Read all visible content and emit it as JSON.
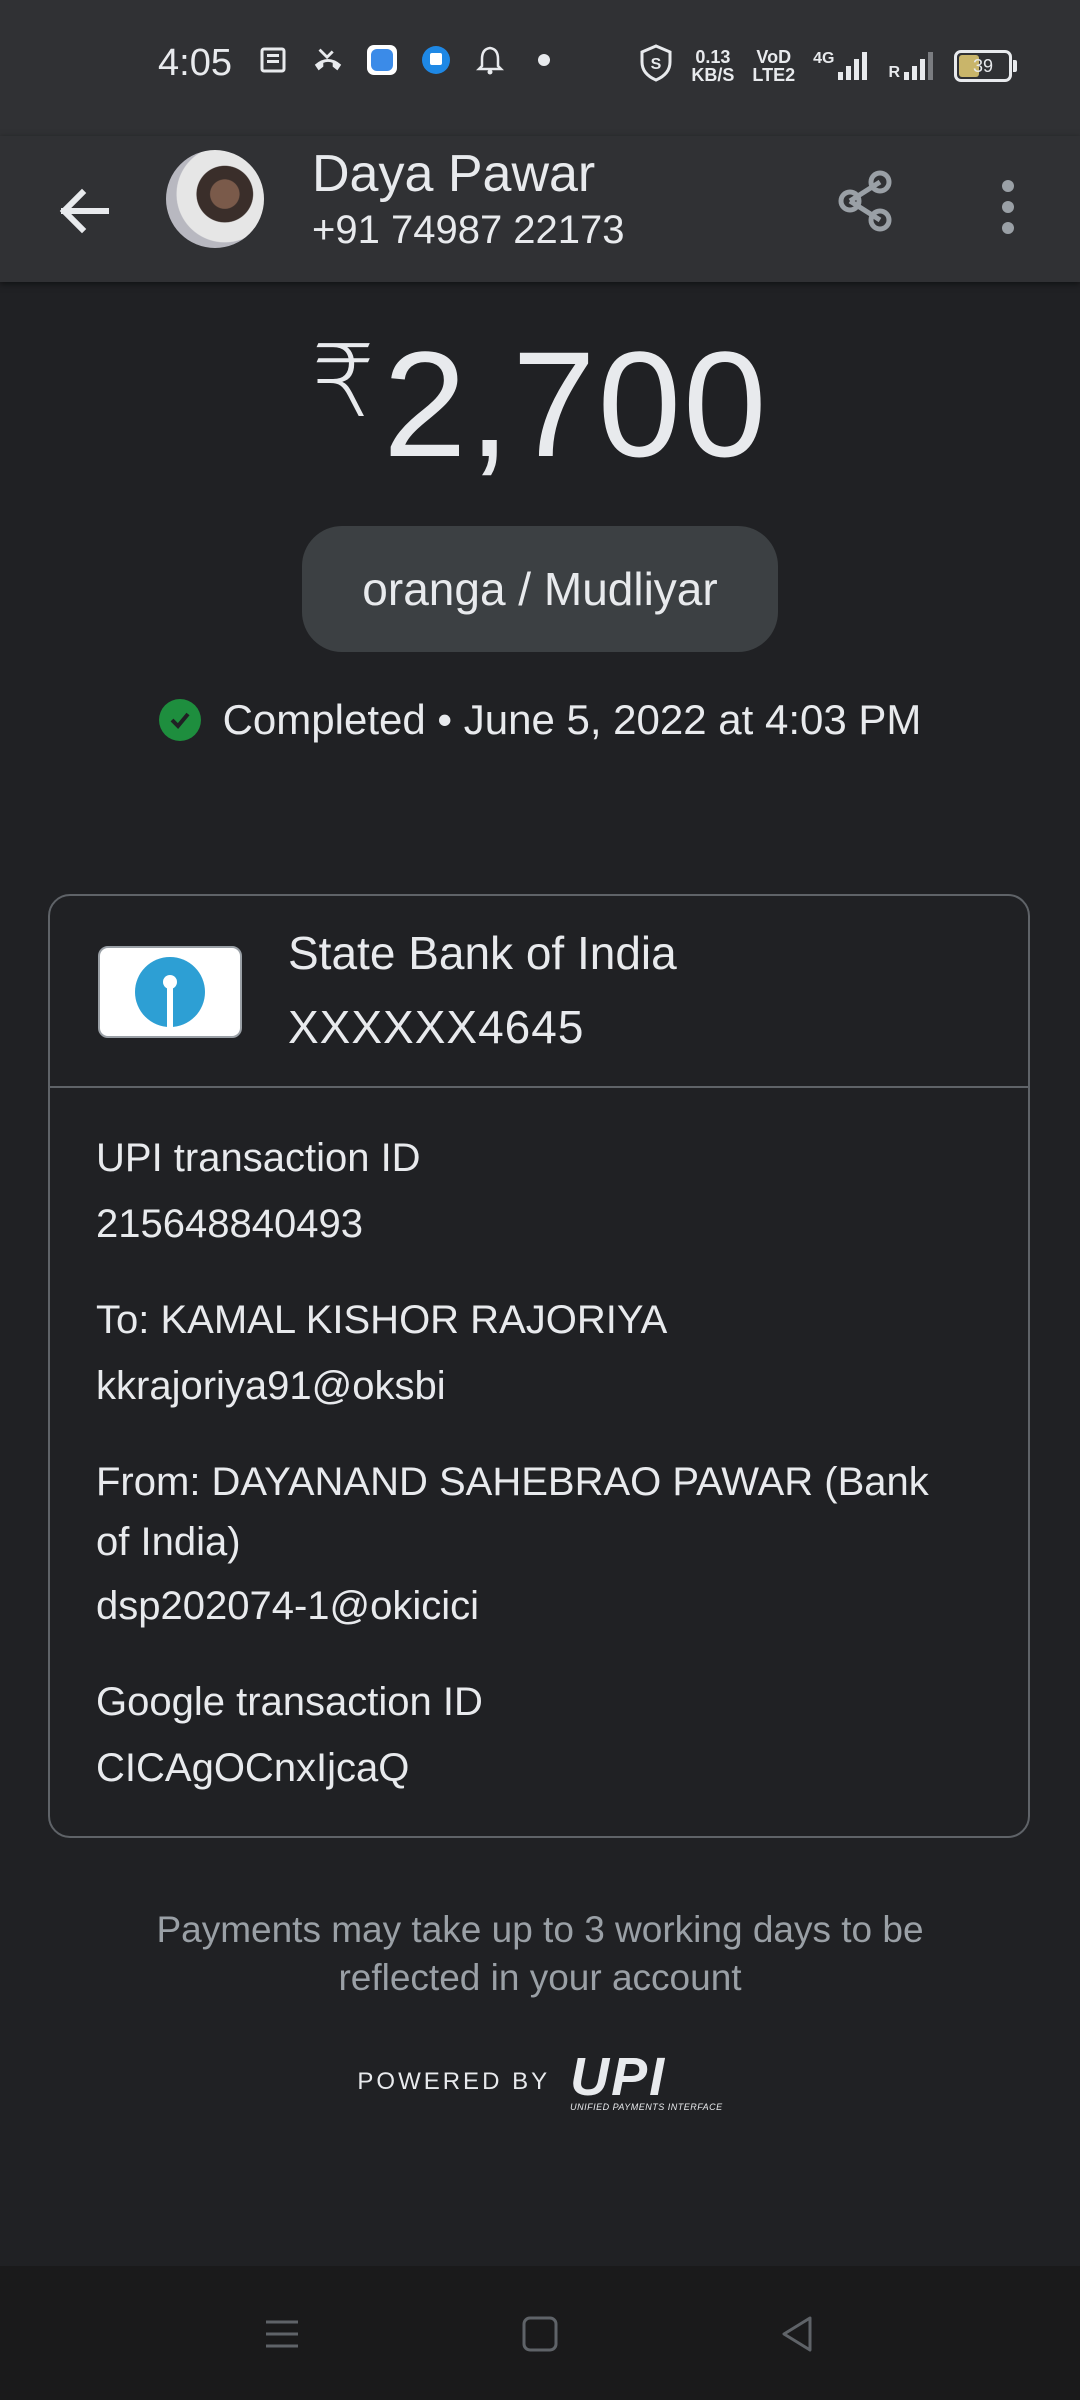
{
  "status_bar": {
    "time": "4:05",
    "net_speed_top": "0.13",
    "net_speed_unit": "KB/S",
    "volte_top": "VoD",
    "volte_bottom": "LTE2",
    "network": "4G",
    "roaming": "R",
    "battery": "39"
  },
  "header": {
    "contact_name": "Daya Pawar",
    "contact_phone": "+91 74987 22173"
  },
  "payment": {
    "currency": "₹",
    "amount": "2,700",
    "note": "oranga / Mudliyar",
    "status": "Completed • June 5, 2022 at 4:03 PM"
  },
  "bank": {
    "name": "State Bank of India",
    "account": "XXXXXX4645"
  },
  "details": {
    "upi_label": "UPI transaction ID",
    "upi_value": "215648840493",
    "to_label": "To: KAMAL KISHOR  RAJORIYA",
    "to_value": "kkrajoriya91@oksbi",
    "from_label_line1": "From: DAYANAND SAHEBRAO PAWAR (Bank",
    "from_label_line2": "of India)",
    "from_value": "dsp202074-1@okicici",
    "google_label": "Google transaction ID",
    "google_value": "CICAgOCnxIjcaQ"
  },
  "footer": {
    "note": "Payments may take up to 3 working days to be reflected in your account",
    "powered_by": "POWERED BY",
    "upi_logo": "UPI",
    "upi_subtitle": "UNIFIED PAYMENTS INTERFACE"
  },
  "colors": {
    "background": "#202124",
    "appbar": "#303134",
    "success": "#1e8e3e",
    "sbi_blue": "#2d9fd4"
  }
}
